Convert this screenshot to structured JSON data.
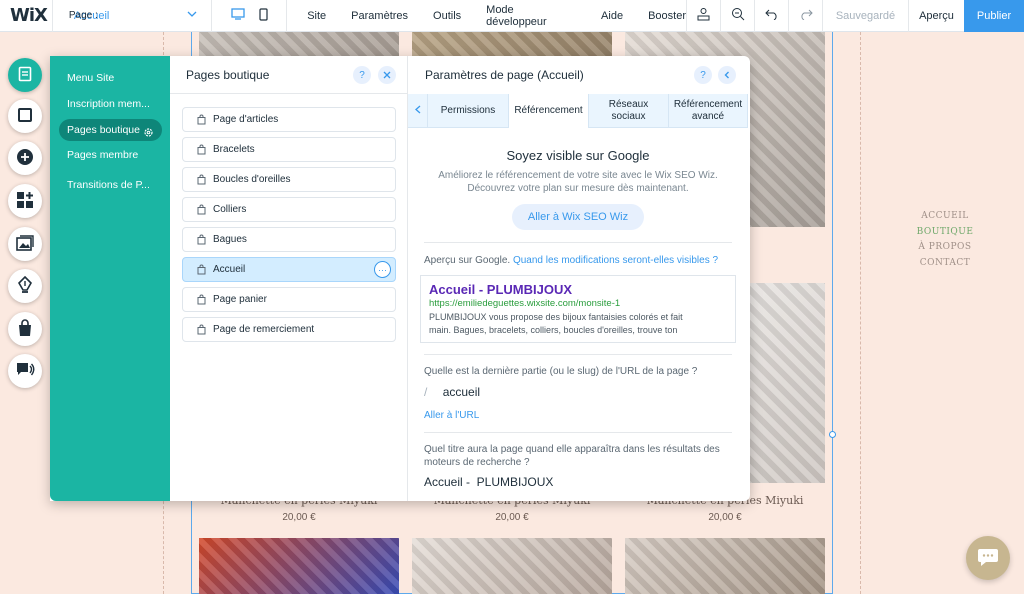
{
  "topbar": {
    "logo": "WiX",
    "page_label": "Page :",
    "page_value": "Accueil",
    "menu": [
      "Site",
      "Paramètres",
      "Outils",
      "Mode développeur",
      "Aide",
      "Booster"
    ],
    "saved": "Sauvegardé",
    "preview": "Aperçu",
    "publish": "Publier"
  },
  "left_rail": {
    "icons": [
      "pages-icon",
      "layout-icon",
      "add-icon",
      "apps-icon",
      "media-icon",
      "blog-pen-icon",
      "store-bag-icon",
      "chat-icon"
    ]
  },
  "site_menu": {
    "items": [
      "Menu Site",
      "Inscription mem...",
      "Pages boutique",
      "Pages membre",
      "Transitions de P..."
    ],
    "selected": "Pages boutique"
  },
  "pages_boutique": {
    "title": "Pages boutique",
    "pages": [
      "Page d'articles",
      "Bracelets",
      "Boucles d'oreilles",
      "Colliers",
      "Bagues",
      "Accueil",
      "Page panier",
      "Page de remerciement"
    ],
    "selected": "Accueil"
  },
  "page_params": {
    "title": "Paramètres de page (Accueil)",
    "tabs": [
      "Permissions",
      "Référencement",
      "Réseaux sociaux",
      "Référencement avancé"
    ],
    "active_tab": "Référencement",
    "seo_heading": "Soyez visible sur Google",
    "seo_text_1": "Améliorez le référencement de votre site avec le Wix SEO Wiz.",
    "seo_text_2": "Découvrez votre plan sur mesure dès maintenant.",
    "seo_button": "Aller à Wix SEO Wiz",
    "google_preview_label": "Aperçu sur Google.",
    "google_preview_link": "Quand les modifications seront-elles visibles ?",
    "google_title": "Accueil - PLUMBIJOUX",
    "google_url": "https://emiliedeguettes.wixsite.com/monsite-1",
    "google_desc_1": "PLUMBIJOUX vous propose des bijoux fantaisies colorés et fait",
    "google_desc_2": "main. Bagues, bracelets, colliers, boucles d'oreilles, trouve ton",
    "slug_question": "Quelle est la dernière partie (ou le slug) de l'URL de la page ?",
    "slug_prefix": "/",
    "slug_value": "accueil",
    "slug_link": "Aller à l'URL",
    "seo_title_question": "Quel titre aura la page quand elle apparaîtra dans les résultats des moteurs de recherche ?",
    "seo_title_value": "Accueil -  PLUMBIJOUX"
  },
  "site_canvas": {
    "product_name_partial": "Miyuki",
    "products": [
      {
        "title": "Manchette en perles Miyuki",
        "price": "20,00 €"
      },
      {
        "title": "Manchette en perles Miyuki",
        "price": "20,00 €"
      },
      {
        "title": "Manchette en perles Miyuki",
        "price": "20,00 €"
      }
    ],
    "nav": [
      "ACCUEIL",
      "BOUTIQUE",
      "À PROPOS",
      "CONTACT"
    ],
    "nav_active": "BOUTIQUE"
  },
  "colors": {
    "accent": "#3899ec",
    "teal": "#1bb5a3",
    "canvas_bg": "#fbe9e0"
  }
}
